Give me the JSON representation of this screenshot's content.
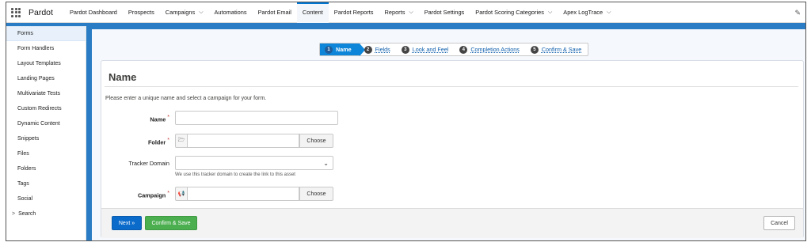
{
  "app": {
    "name": "Pardot"
  },
  "nav": {
    "items": [
      {
        "label": "Pardot Dashboard",
        "has_menu": false,
        "active": false
      },
      {
        "label": "Prospects",
        "has_menu": false,
        "active": false
      },
      {
        "label": "Campaigns",
        "has_menu": true,
        "active": false
      },
      {
        "label": "Automations",
        "has_menu": false,
        "active": false
      },
      {
        "label": "Pardot Email",
        "has_menu": false,
        "active": false
      },
      {
        "label": "Content",
        "has_menu": false,
        "active": true
      },
      {
        "label": "Pardot Reports",
        "has_menu": false,
        "active": false
      },
      {
        "label": "Reports",
        "has_menu": true,
        "active": false
      },
      {
        "label": "Pardot Settings",
        "has_menu": false,
        "active": false
      },
      {
        "label": "Pardot Scoring Categories",
        "has_menu": true,
        "active": false
      },
      {
        "label": "Apex LogTrace",
        "has_menu": true,
        "active": false
      }
    ],
    "chevron": "⌵"
  },
  "sidebar": {
    "items": [
      {
        "label": "Forms",
        "active": true
      },
      {
        "label": "Form Handlers"
      },
      {
        "label": "Layout Templates"
      },
      {
        "label": "Landing Pages"
      },
      {
        "label": "Multivariate Tests"
      },
      {
        "label": "Custom Redirects"
      },
      {
        "label": "Dynamic Content"
      },
      {
        "label": "Snippets"
      },
      {
        "label": "Files"
      },
      {
        "label": "Folders"
      },
      {
        "label": "Tags"
      },
      {
        "label": "Social"
      }
    ],
    "search": {
      "arrow": ">",
      "label": "Search"
    }
  },
  "wizard": {
    "steps": [
      {
        "num": "1",
        "label": "Name",
        "active": true
      },
      {
        "num": "2",
        "label": "Fields"
      },
      {
        "num": "3",
        "label": "Look and Feel"
      },
      {
        "num": "4",
        "label": "Completion Actions"
      },
      {
        "num": "5",
        "label": "Confirm & Save"
      }
    ]
  },
  "form": {
    "title": "Name",
    "intro": "Please enter a unique name and select a campaign for your form.",
    "name": {
      "label": "Name",
      "required": "*",
      "value": ""
    },
    "folder": {
      "label": "Folder",
      "required": "*",
      "value": "",
      "choose": "Choose"
    },
    "tracker": {
      "label": "Tracker Domain",
      "value": "",
      "help": "We use this tracker domain to create the link to this asset"
    },
    "campaign": {
      "label": "Campaign",
      "required": "*",
      "value": "",
      "choose": "Choose"
    }
  },
  "footer": {
    "next": "Next »",
    "confirm": "Confirm & Save",
    "cancel": "Cancel"
  },
  "colors": {
    "accent": "#0176d3",
    "band": "#2a7dc4",
    "step_active": "#0d86d9",
    "confirm_green": "#4bae4f",
    "next_blue": "#0b6bcb",
    "required": "#c23934"
  }
}
